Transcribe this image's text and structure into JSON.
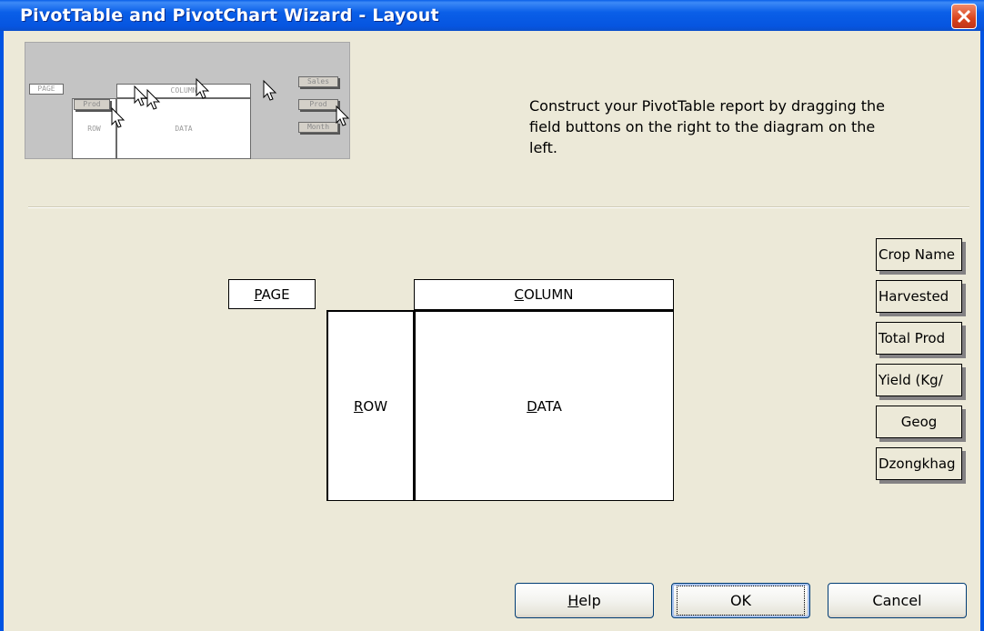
{
  "window": {
    "title": "PivotTable and PivotChart Wizard - Layout"
  },
  "preview": {
    "page_label": "PAGE",
    "column_label": "COLUMN",
    "row_label": "ROW",
    "data_label": "DATA",
    "prod_label": "Prod",
    "buttons": [
      "Sales",
      "Prod",
      "Month"
    ]
  },
  "instructions": "Construct your PivotTable report by dragging the field buttons on the right to the diagram on the left.",
  "diagram": {
    "page_rest": "AGE",
    "page_key": "P",
    "column_rest": "OLUMN",
    "column_key": "C",
    "row_rest": "OW",
    "row_key": "R",
    "data_rest": "ATA",
    "data_key": "D"
  },
  "fields": [
    "Crop Name",
    "Harvested",
    "Total Prod",
    "Yield (Kg/",
    "Geog",
    "Dzongkhag"
  ],
  "buttons": {
    "help_key": "H",
    "help_rest": "elp",
    "ok": "OK",
    "cancel": "Cancel"
  },
  "colors": {
    "titlebar": "#0054E3",
    "close": "#D8431C",
    "dialog_bg": "#ECE9D8"
  }
}
